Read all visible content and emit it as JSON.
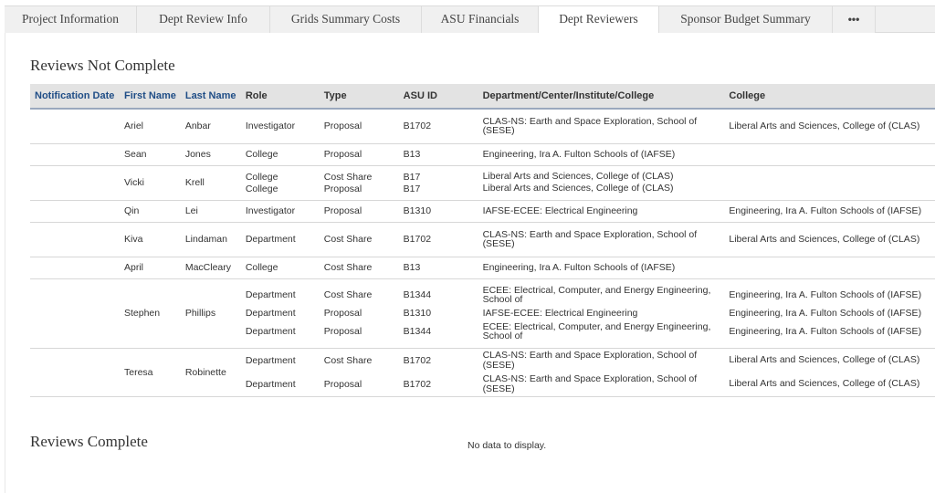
{
  "tabs": [
    {
      "label": "Project Information"
    },
    {
      "label": "Dept Review Info"
    },
    {
      "label": "Grids Summary Costs"
    },
    {
      "label": "ASU Financials"
    },
    {
      "label": "Dept Reviewers",
      "active": true
    },
    {
      "label": "Sponsor Budget Summary"
    },
    {
      "label": "•••"
    }
  ],
  "not_complete": {
    "title": "Reviews Not Complete",
    "columns": [
      "Notification Date",
      "First Name",
      "Last Name",
      "Role",
      "Type",
      "ASU ID",
      "Department/Center/Institute/College",
      "College"
    ],
    "rows": [
      {
        "notification_date": "",
        "first": "Ariel",
        "last": "Anbar",
        "entries": [
          {
            "role": "Investigator",
            "type": "Proposal",
            "asu_id": "B1702",
            "dept": "CLAS-NS: Earth and Space Exploration, School of (SESE)",
            "college": "Liberal Arts and Sciences, College of (CLAS)"
          }
        ]
      },
      {
        "notification_date": "",
        "first": "Sean",
        "last": "Jones",
        "entries": [
          {
            "role": "College",
            "type": "Proposal",
            "asu_id": "B13",
            "dept": "Engineering, Ira A. Fulton Schools of (IAFSE)",
            "college": ""
          }
        ]
      },
      {
        "notification_date": "",
        "first": "Vicki",
        "last": "Krell",
        "entries": [
          {
            "role": "College",
            "type": "Cost Share",
            "asu_id": "B17",
            "dept": "Liberal Arts and Sciences, College of (CLAS)",
            "college": ""
          },
          {
            "role": "College",
            "type": "Proposal",
            "asu_id": "B17",
            "dept": "Liberal Arts and Sciences, College of (CLAS)",
            "college": ""
          }
        ]
      },
      {
        "notification_date": "",
        "first": "Qin",
        "last": "Lei",
        "entries": [
          {
            "role": "Investigator",
            "type": "Proposal",
            "asu_id": "B1310",
            "dept": "IAFSE-ECEE: Electrical Engineering",
            "college": "Engineering, Ira A. Fulton Schools of (IAFSE)"
          }
        ]
      },
      {
        "notification_date": "",
        "first": "Kiva",
        "last": "Lindaman",
        "entries": [
          {
            "role": "Department",
            "type": "Cost Share",
            "asu_id": "B1702",
            "dept": "CLAS-NS: Earth and Space Exploration, School of (SESE)",
            "college": "Liberal Arts and Sciences, College of (CLAS)"
          }
        ]
      },
      {
        "notification_date": "",
        "first": "April",
        "last": "MacCleary",
        "entries": [
          {
            "role": "College",
            "type": "Cost Share",
            "asu_id": "B13",
            "dept": "Engineering, Ira A. Fulton Schools of (IAFSE)",
            "college": ""
          }
        ]
      },
      {
        "notification_date": "",
        "first": "Stephen",
        "last": "Phillips",
        "entries": [
          {
            "role": "Department",
            "type": "Cost Share",
            "asu_id": "B1344",
            "dept": "ECEE: Electrical, Computer, and Energy Engineering, School of",
            "college": "Engineering, Ira A. Fulton Schools of (IAFSE)"
          },
          {
            "role": "Department",
            "type": "Proposal",
            "asu_id": "B1310",
            "dept": "IAFSE-ECEE: Electrical Engineering",
            "college": "Engineering, Ira A. Fulton Schools of (IAFSE)"
          },
          {
            "role": "Department",
            "type": "Proposal",
            "asu_id": "B1344",
            "dept": "ECEE: Electrical, Computer, and Energy Engineering, School of",
            "college": "Engineering, Ira A. Fulton Schools of (IAFSE)"
          }
        ]
      },
      {
        "notification_date": "",
        "first": "Teresa",
        "last": "Robinette",
        "entries": [
          {
            "role": "Department",
            "type": "Cost Share",
            "asu_id": "B1702",
            "dept": "CLAS-NS: Earth and Space Exploration, School of (SESE)",
            "college": "Liberal Arts and Sciences, College of (CLAS)"
          },
          {
            "role": "Department",
            "type": "Proposal",
            "asu_id": "B1702",
            "dept": "CLAS-NS: Earth and Space Exploration, School of (SESE)",
            "college": "Liberal Arts and Sciences, College of (CLAS)"
          }
        ]
      }
    ]
  },
  "complete": {
    "title": "Reviews Complete",
    "empty_text": "No data to display."
  },
  "colors": {
    "header_bg": "#e3e3e3",
    "header_link": "#1f4d86",
    "header_border": "#9aa8bd",
    "tab_bg": "#f0f0f0"
  }
}
